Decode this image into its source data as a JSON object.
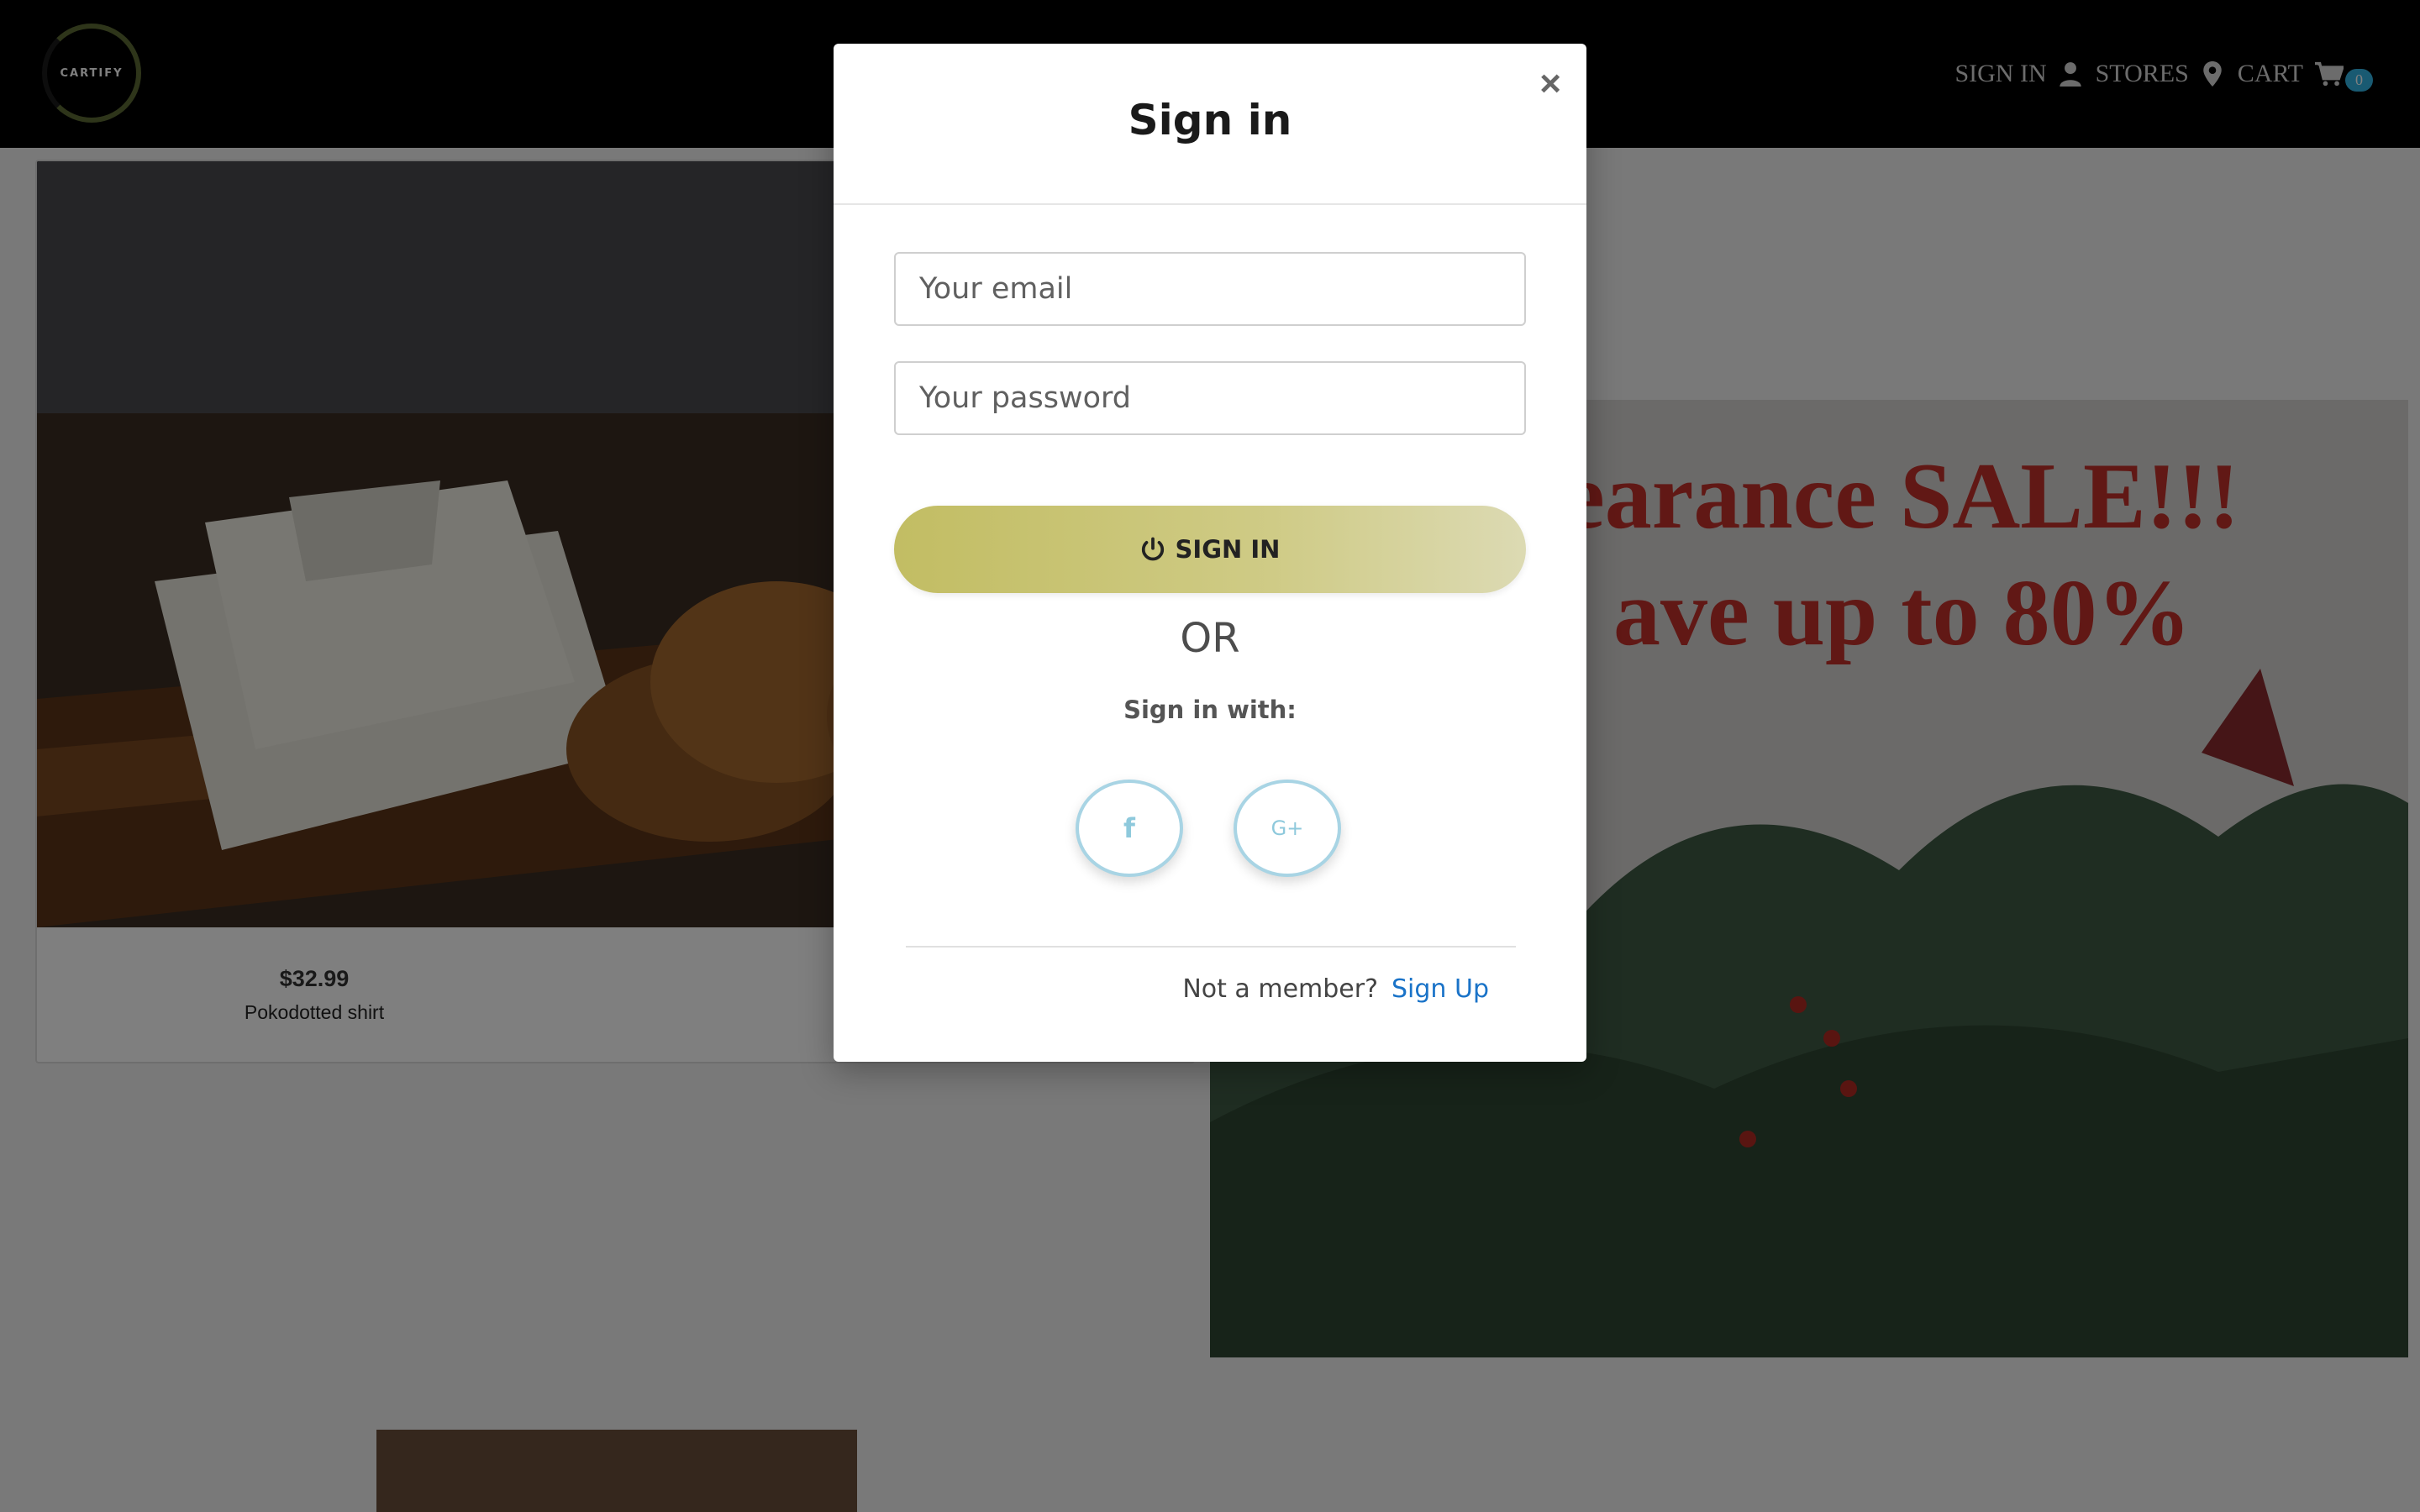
{
  "nav": {
    "logo_text": "CARTIFY",
    "sign_in": "SIGN IN",
    "stores": "STORES",
    "cart": "CART",
    "cart_count": "0"
  },
  "product": {
    "price": "$32.99",
    "name": "Pokodotted shirt"
  },
  "banner": {
    "line1": "earance SALE!!!",
    "line2": "ave up to 80%"
  },
  "modal": {
    "title": "Sign in",
    "close": "×",
    "email_placeholder": "Your email",
    "password_placeholder": "Your password",
    "signin_button": "SIGN IN",
    "or_text": "OR",
    "signin_with": "Sign in with:",
    "facebook_glyph": "f",
    "google_glyph": "G+",
    "not_member": "Not a member?",
    "signup": "Sign Up"
  },
  "colors": {
    "accent_button_start": "#c2bd63",
    "accent_button_end": "#dcdab3",
    "social_border": "#a8d4e4",
    "link": "#1a73c8",
    "banner_text": "#c2302a",
    "cart_badge": "#33b5e5"
  }
}
